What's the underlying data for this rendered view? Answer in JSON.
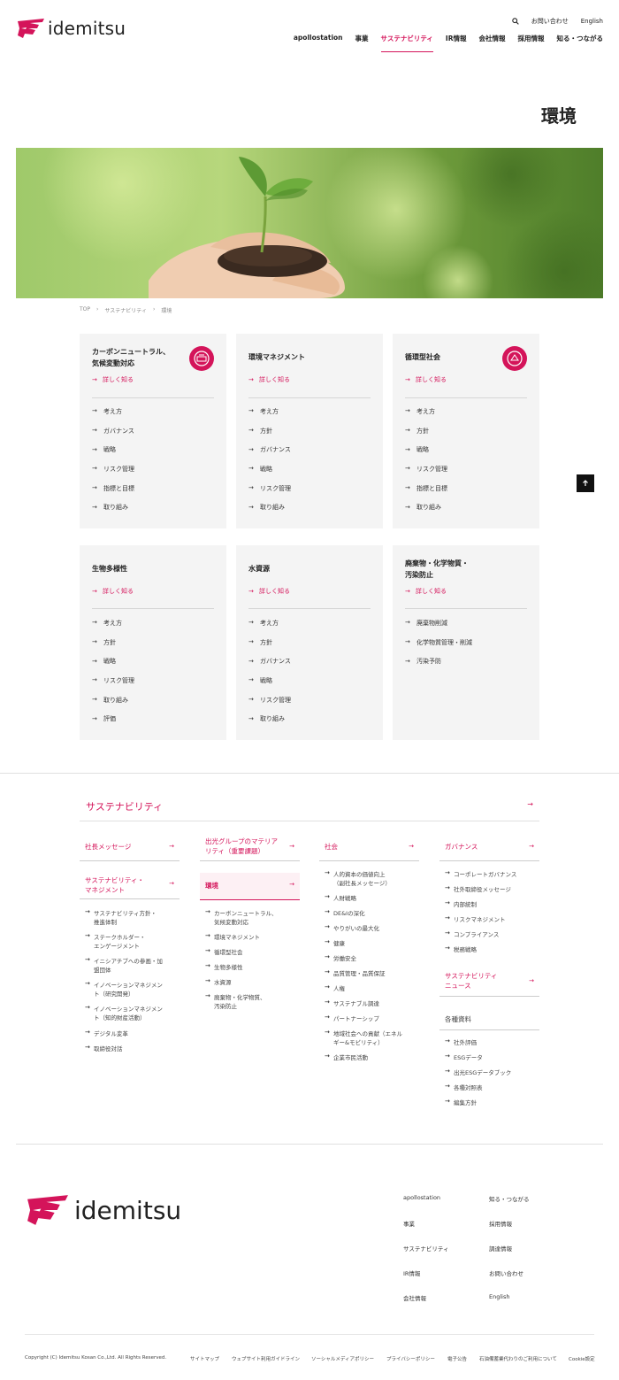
{
  "header": {
    "logo_text": "idemitsu",
    "util": {
      "contact": "お問い合わせ",
      "english": "English"
    },
    "nav": [
      {
        "label": "apollostation",
        "active": false
      },
      {
        "label": "事業",
        "active": false
      },
      {
        "label": "サステナビリティ",
        "active": true
      },
      {
        "label": "IR情報",
        "active": false
      },
      {
        "label": "会社情報",
        "active": false
      },
      {
        "label": "採用情報",
        "active": false
      },
      {
        "label": "知る・つながる",
        "active": false
      }
    ]
  },
  "page_title": "環境",
  "breadcrumb": [
    "TOP",
    "サステナビリティ",
    "環境"
  ],
  "more_label": "詳しく知る",
  "cards": [
    {
      "title": "カーボンニュートラル、\n気候変動対応",
      "badge": true,
      "links": [
        "考え方",
        "ガバナンス",
        "戦略",
        "リスク管理",
        "指標と目標",
        "取り組み"
      ]
    },
    {
      "title": "環境マネジメント",
      "badge": false,
      "links": [
        "考え方",
        "方針",
        "ガバナンス",
        "戦略",
        "リスク管理",
        "取り組み"
      ]
    },
    {
      "title": "循環型社会",
      "badge": true,
      "links": [
        "考え方",
        "方針",
        "戦略",
        "リスク管理",
        "指標と目標",
        "取り組み"
      ]
    },
    {
      "title": "生物多様性",
      "badge": false,
      "links": [
        "考え方",
        "方針",
        "戦略",
        "リスク管理",
        "取り組み",
        "評価"
      ]
    },
    {
      "title": "水資源",
      "badge": false,
      "links": [
        "考え方",
        "方針",
        "ガバナンス",
        "戦略",
        "リスク管理",
        "取り組み"
      ]
    },
    {
      "title": "廃棄物・化学物質・\n汚染防止",
      "badge": false,
      "links": [
        "廃棄物削減",
        "化学物質管理・削減",
        "汚染予防"
      ]
    }
  ],
  "sitemap": {
    "heading": "サステナビリティ",
    "col1": {
      "cat1": "社長メッセージ",
      "cat2": "サステナビリティ・\nマネジメント",
      "links": [
        "サステナビリティ方針・\n推進体制",
        "ステークホルダー・\nエンゲージメント",
        "イニシアチブへの参画・加\n盟団体",
        "イノベーションマネジメン\nト（研究開発）",
        "イノベーションマネジメン\nト（知的財産活動）",
        "デジタル変革",
        "取締役対話"
      ]
    },
    "col2": {
      "cat1": "出光グループのマテリア\nリティ（重要課題）",
      "cat2": "環境",
      "links": [
        "カーボンニュートラル、\n気候変動対応",
        "環境マネジメント",
        "循環型社会",
        "生物多様性",
        "水資源",
        "廃棄物・化学物質、\n汚染防止"
      ]
    },
    "col3": {
      "cat1": "社会",
      "links": [
        "人的資本の価値向上\n（副社長メッセージ）",
        "人財戦略",
        "DE&Iの深化",
        "やりがいの最大化",
        "健康",
        "労働安全",
        "品質管理・品質保証",
        "人権",
        "サステナブル調達",
        "パートナーシップ",
        "地域社会への貢献（エネル\nギー&モビリティ）",
        "企業市民活動"
      ]
    },
    "col4": {
      "cat1": "ガバナンス",
      "links1": [
        "コーポレートガバナンス",
        "社外取締役メッセージ",
        "内部統制",
        "リスクマネジメント",
        "コンプライアンス",
        "税務戦略"
      ],
      "cat2": "サステナビリティ\nニュース",
      "plain": "各種資料",
      "links2": [
        "社外評価",
        "ESGデータ",
        "出光ESGデータブック",
        "各種対照表",
        "編集方針"
      ]
    }
  },
  "footer": {
    "logo_text": "idemitsu",
    "nav_left": [
      "apollostation",
      "事業",
      "サステナビリティ",
      "IR情報",
      "会社情報"
    ],
    "nav_right": [
      "知る・つながる",
      "採用情報",
      "調達情報",
      "お問い合わせ",
      "English"
    ],
    "copyright": "Copyright (C) Idemitsu Kosan Co.,Ltd. All Rights Reserved.",
    "bottom_links": [
      "サイトマップ",
      "ウェブサイト利用ガイドライン",
      "ソーシャルメディアポリシー",
      "プライバシーポリシー",
      "電子公告",
      "石油備蓄業代わりのご利用について",
      "Cookie設定"
    ]
  },
  "colors": {
    "accent": "#d4145a",
    "card_bg": "#f4f4f4"
  }
}
